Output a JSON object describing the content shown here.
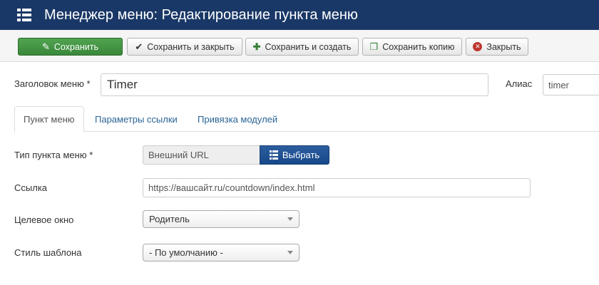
{
  "header": {
    "title": "Менеджер меню: Редактирование пункта меню",
    "icon": "list-menu-icon"
  },
  "toolbar": {
    "save": "Сохранить",
    "save_close": "Сохранить и закрыть",
    "save_new": "Сохранить и создать",
    "save_copy": "Сохранить копию",
    "close": "Закрыть",
    "colors": {
      "save_bg": "#3f8f3f",
      "select_bg": "#1f508f",
      "header_bg": "#1a3867"
    }
  },
  "form": {
    "title_label": "Заголовок меню *",
    "title_value": "Timer",
    "alias_label": "Алиас",
    "alias_value": "timer"
  },
  "tabs": [
    {
      "label": "Пункт меню",
      "active": true
    },
    {
      "label": "Параметры ссылки",
      "active": false
    },
    {
      "label": "Привязка модулей",
      "active": false
    }
  ],
  "fields": {
    "type_label": "Тип пункта меню *",
    "type_value": "Внешний URL",
    "select_button": "Выбрать",
    "link_label": "Ссылка",
    "link_value": "https://вашсайт.ru/countdown/index.html",
    "target_label": "Целевое окно",
    "target_value": "Родитель",
    "style_label": "Стиль шаблона",
    "style_value": "- По умолчанию -"
  }
}
